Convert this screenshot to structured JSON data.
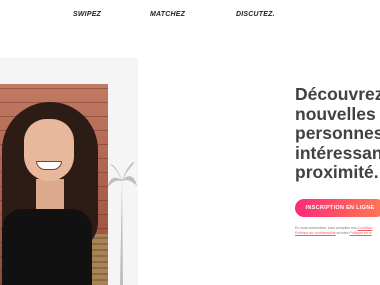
{
  "nav": {
    "items": [
      {
        "label": "SWIPEZ"
      },
      {
        "label": "MATCHEZ"
      },
      {
        "label": "DISCUTEZ."
      }
    ]
  },
  "hero": {
    "title_lines": [
      "Découvrez",
      "nouvelles",
      "personnes",
      "intéressant",
      "proximité."
    ],
    "cta_label": "INSCRIPTION EN LIGNE",
    "legal": {
      "line1_text": "En vous connectant, vous acceptez nos",
      "line1_link": "Condition",
      "line2_link": "Politique de confidentialité",
      "line2_text": "et notre",
      "line2_link2": "Politique en m"
    }
  },
  "colors": {
    "cta_gradient_start": "#fd2a7b",
    "cta_gradient_end": "#ff7854",
    "title": "#424242"
  }
}
